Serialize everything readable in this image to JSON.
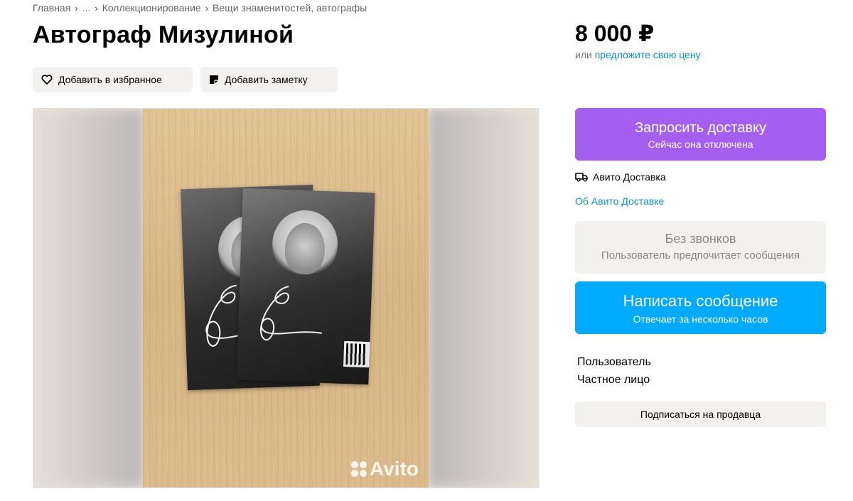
{
  "breadcrumb": {
    "items": [
      "Главная",
      "...",
      "Коллекционирование",
      "Вещи знаменитостей, автографы"
    ],
    "separator": "›"
  },
  "listing": {
    "title": "Автограф Мизулиной",
    "price": "8 000 ₽",
    "offer_prefix": "или",
    "offer_link": "предложите свою цену"
  },
  "actions": {
    "favorite_label": "Добавить в избранное",
    "note_label": "Добавить заметку"
  },
  "gallery": {
    "watermark": "Avito"
  },
  "delivery": {
    "button_title": "Запросить доставку",
    "button_subtitle": "Сейчас она отключена",
    "service_label": "Авито Доставка",
    "about_link": "Об Авито Доставке"
  },
  "contact": {
    "no_calls_title": "Без звонков",
    "no_calls_subtitle": "Пользователь предпочитает сообщения",
    "message_title": "Написать сообщение",
    "message_subtitle": "Отвечает за несколько часов"
  },
  "seller": {
    "name": "Пользователь",
    "type": "Частное лицо",
    "subscribe_label": "Подписаться на продавца"
  },
  "colors": {
    "accent_purple": "#a45ff0",
    "accent_blue": "#00aaff",
    "link_blue": "#0a8fd9",
    "pill_bg": "#f2f1f0"
  }
}
